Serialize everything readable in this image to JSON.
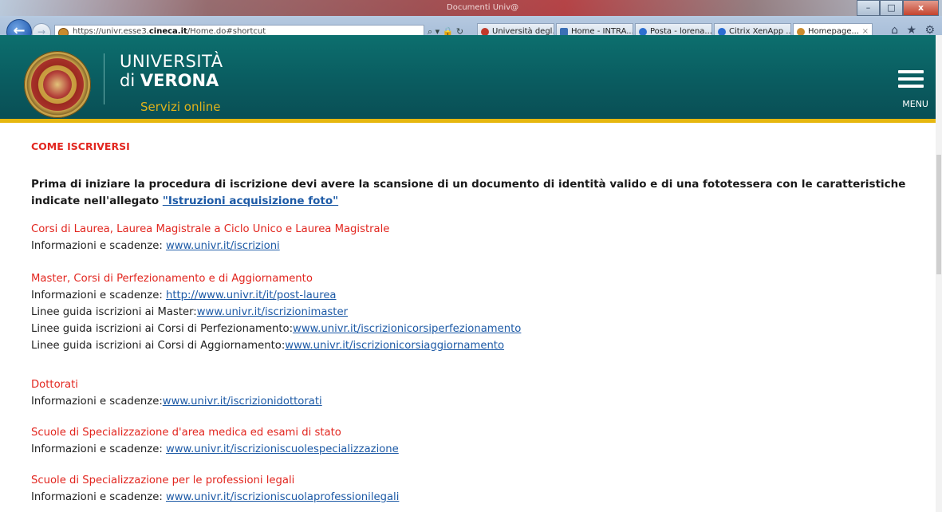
{
  "browser": {
    "title": "Documenti Univ@",
    "url_prefix": "https://univr.esse3.",
    "url_domain": "cineca.it",
    "url_suffix": "/Home.do#shortcut",
    "addr_tools": "⌕ ▾ 🔒 ↻",
    "tabs": [
      {
        "label": "Università degl...",
        "color": "#c0392b"
      },
      {
        "label": "Home - INTRA...",
        "color": "#3b6fb5"
      },
      {
        "label": "Posta - lorena....",
        "color": "#2d6fcf"
      },
      {
        "label": "Citrix XenApp ...",
        "color": "#2b6cd1"
      },
      {
        "label": "Homepage...",
        "color": "#c98b2e"
      }
    ],
    "close_tab": "×",
    "fav_icons": "⌂ ★ ⚙",
    "win_min": "–",
    "win_max": "□",
    "win_close": "x"
  },
  "header": {
    "univ_line1": "UNIVERSITÀ",
    "univ_line2_prefix": "di",
    "univ_line2_bold": "VERONA",
    "servizi": "Servizi online",
    "menu_label": "MENU"
  },
  "content": {
    "section_title": "COME ISCRIVERSI",
    "intro_text": "Prima di iniziare la procedura di iscrizione devi avere la scansione di un documento di identità valido e di una fototessera con le caratteristiche indicate nell'allegato ",
    "intro_link": "\"Istruzioni acquisizione foto\"",
    "blocks": [
      {
        "heading": "Corsi di Laurea, Laurea Magistrale a Ciclo Unico e Laurea Magistrale",
        "lines": [
          {
            "text": "Informazioni e scadenze: ",
            "link": "www.univr.it/iscrizioni"
          }
        ]
      },
      {
        "heading": "Master, Corsi di Perfezionamento e di Aggiornamento",
        "lines": [
          {
            "text": "Informazioni e scadenze: ",
            "link": "http://www.univr.it/it/post-laurea"
          },
          {
            "text": "Linee guida iscrizioni ai Master:",
            "link": "www.univr.it/iscrizionimaster"
          },
          {
            "text": "Linee guida iscrizioni ai Corsi di Perfezionamento:",
            "link": "www.univr.it/iscrizionicorsiperfezionamento"
          },
          {
            "text": "Linee guida iscrizioni ai Corsi di Aggiornamento:",
            "link": "www.univr.it/iscrizionicorsiaggiornamento"
          }
        ]
      },
      {
        "heading": "Dottorati",
        "lines": [
          {
            "text": "Informazioni e scadenze:",
            "link": "www.univr.it/iscrizionidottorati"
          }
        ]
      },
      {
        "heading": "Scuole di Specializzazione d'area medica ed esami di stato",
        "lines": [
          {
            "text": "Informazioni e scadenze: ",
            "link": "www.univr.it/iscrizioniscuolespecializzazione"
          }
        ]
      },
      {
        "heading": "Scuole di Specializzazione per le professioni legali",
        "lines": [
          {
            "text": "Informazioni e scadenze: ",
            "link": "www.univr.it/iscrizioniscuolaprofessionilegali"
          }
        ]
      }
    ]
  }
}
